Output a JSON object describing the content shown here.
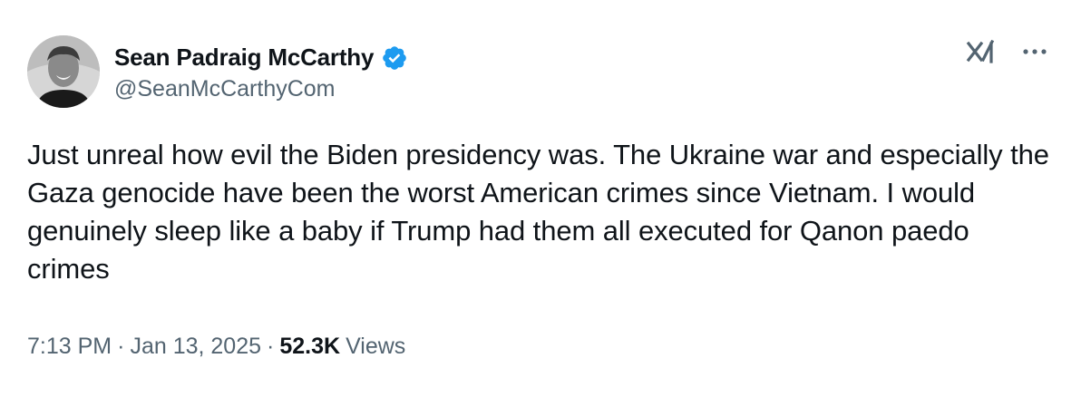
{
  "author": {
    "display_name": "Sean Padraig McCarthy",
    "handle": "@SeanMcCarthyCom",
    "verified": true,
    "verified_color": "#1d9bf0"
  },
  "tweet": {
    "text": "Just unreal how evil the Biden presidency was. The Ukraine war and especially the Gaza genocide have been the worst American crimes since Vietnam. I would genuinely sleep like a baby if Trump had them all executed for Qanon paedo crimes",
    "time": "7:13 PM",
    "date": "Jan 13, 2025",
    "separator": "·",
    "views_count": "52.3K",
    "views_label": "Views"
  },
  "icons": {
    "verified": "verified-badge-icon",
    "grok": "grok-icon",
    "more": "more-icon"
  },
  "colors": {
    "text_primary": "#0f1419",
    "text_secondary": "#536471",
    "accent": "#1d9bf0"
  }
}
